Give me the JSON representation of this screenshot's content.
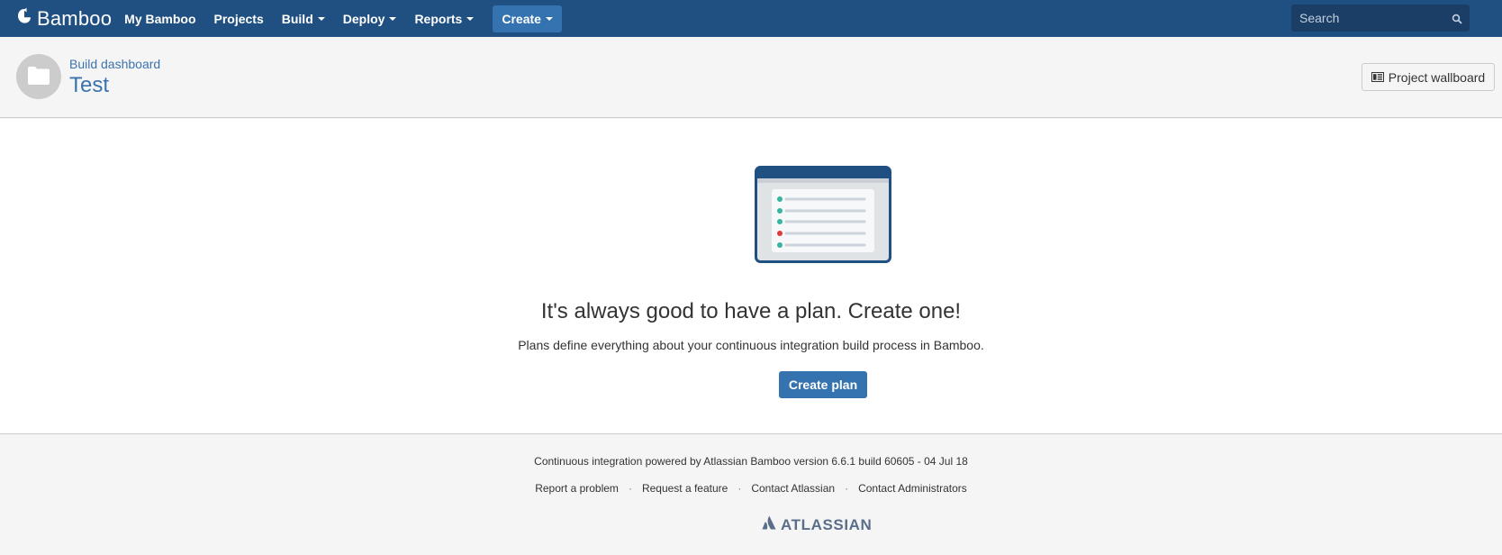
{
  "header": {
    "app_name": "Bamboo",
    "nav": [
      {
        "label": "My Bamboo",
        "dropdown": false
      },
      {
        "label": "Projects",
        "dropdown": false
      },
      {
        "label": "Build",
        "dropdown": true
      },
      {
        "label": "Deploy",
        "dropdown": true
      },
      {
        "label": "Reports",
        "dropdown": true
      }
    ],
    "create_label": "Create",
    "search_placeholder": "Search"
  },
  "page": {
    "breadcrumb": "Build dashboard",
    "title": "Test",
    "wallboard_label": "Project wallboard"
  },
  "empty_state": {
    "headline": "It's always good to have a plan. Create one!",
    "description": "Plans define everything about your continuous integration build process in Bamboo.",
    "button_label": "Create plan"
  },
  "footer": {
    "powered_by": "Continuous integration powered by Atlassian Bamboo version 6.6.1 build 60605 - 04 Jul 18",
    "links": [
      "Report a problem",
      "Request a feature",
      "Contact Atlassian",
      "Contact Administrators"
    ],
    "separator": "·",
    "brand": "ATLASSIAN"
  },
  "colors": {
    "header_bg": "#205081",
    "accent": "#3572b0",
    "link": "#3b73af",
    "status_ok": "#36b37e",
    "status_fail": "#de350b"
  },
  "icons": [
    "bamboo-logo-icon",
    "search-icon",
    "folder-icon",
    "wallboard-icon",
    "plan-list-illustration",
    "atlassian-logo-icon"
  ]
}
